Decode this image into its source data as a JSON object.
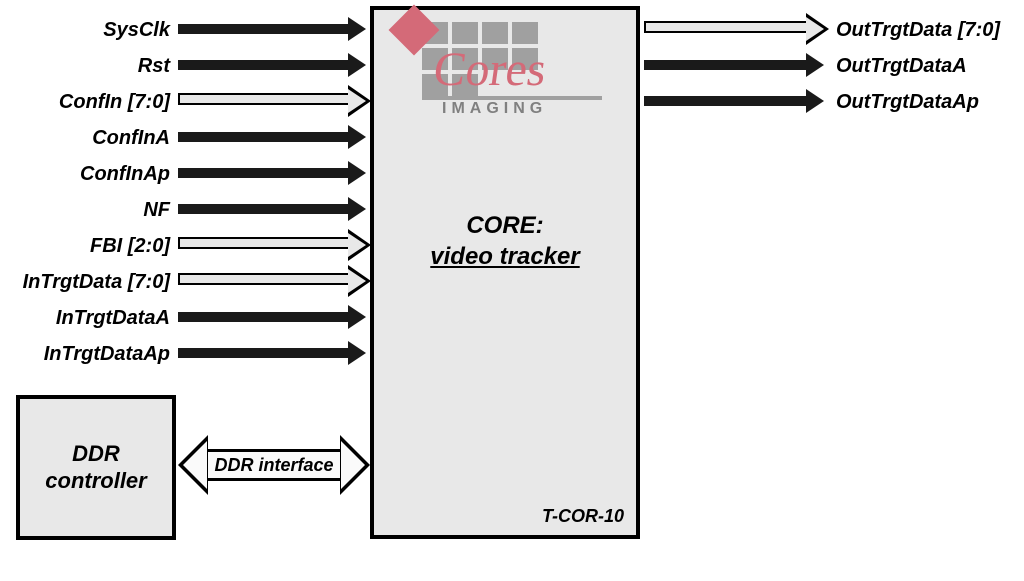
{
  "core": {
    "title_line1": "CORE:",
    "title_line2": "video tracker",
    "part_number": "T-COR-10"
  },
  "logo": {
    "script": "Cores",
    "subtext": "IMAGING"
  },
  "ddr": {
    "controller_label_line1": "DDR",
    "controller_label_line2": "controller",
    "interface_label": "DDR interface"
  },
  "inputs": [
    {
      "name": "SysClk",
      "type": "solid"
    },
    {
      "name": "Rst",
      "type": "solid"
    },
    {
      "name": "ConfIn [7:0]",
      "type": "hollow"
    },
    {
      "name": "ConfInA",
      "type": "solid"
    },
    {
      "name": "ConfInAp",
      "type": "solid"
    },
    {
      "name": "NF",
      "type": "solid"
    },
    {
      "name": "FBI [2:0]",
      "type": "hollow"
    },
    {
      "name": "InTrgtData [7:0]",
      "type": "hollow"
    },
    {
      "name": "InTrgtDataA",
      "type": "solid"
    },
    {
      "name": "InTrgtDataAp",
      "type": "solid"
    }
  ],
  "outputs": [
    {
      "name": "OutTrgtData [7:0]",
      "type": "hollow"
    },
    {
      "name": "OutTrgtDataA",
      "type": "solid"
    },
    {
      "name": "OutTrgtDataAp",
      "type": "solid"
    }
  ]
}
